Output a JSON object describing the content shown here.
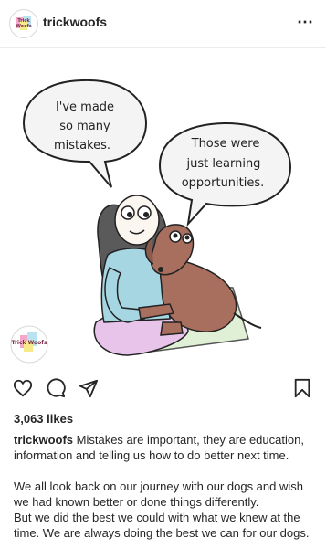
{
  "post": {
    "username": "trickwoofs",
    "avatar_text": "Trick Woofs",
    "more_label": "⋯",
    "image": {
      "bubble_left_lines": [
        "I've made",
        "so many",
        "mistakes."
      ],
      "bubble_right_lines": [
        "Those were",
        "just learning",
        "opportunities."
      ],
      "watermark_text": "Trick Woofs"
    },
    "likes": "3,063 likes",
    "caption": {
      "username": "trickwoofs",
      "line1": "Mistakes are important, they are education, information and telling us how to do better next time.",
      "para2": "We all look back on our journey with our dogs and wish we had known better or done things differently.",
      "para3": "But we did the best we could with what we knew at the time. We are always doing the best we can for our dogs."
    }
  },
  "icons": {
    "like": "heart-icon",
    "comment": "comment-icon",
    "share": "send-icon",
    "save": "bookmark-icon"
  },
  "colors": {
    "text": "#262626",
    "sweater": "#a7d6e3",
    "pants": "#e8c4ea",
    "dog": "#a86f5f",
    "blanket": "#dff0d6"
  }
}
